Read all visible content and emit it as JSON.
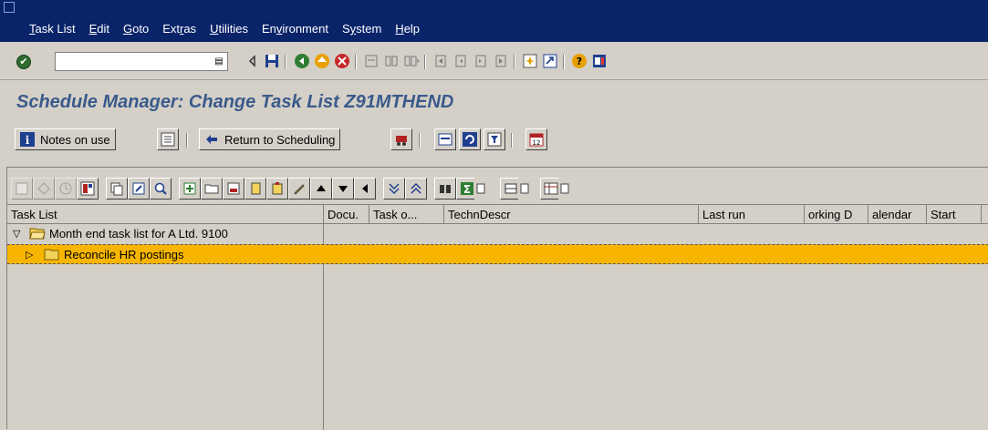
{
  "menu": {
    "items": [
      {
        "pre": "",
        "u": "T",
        "post": "ask List"
      },
      {
        "pre": "",
        "u": "E",
        "post": "dit"
      },
      {
        "pre": "",
        "u": "G",
        "post": "oto"
      },
      {
        "pre": "Ext",
        "u": "r",
        "post": "as"
      },
      {
        "pre": "",
        "u": "U",
        "post": "tilities"
      },
      {
        "pre": "En",
        "u": "v",
        "post": "ironment"
      },
      {
        "pre": "S",
        "u": "y",
        "post": "stem"
      },
      {
        "pre": "",
        "u": "H",
        "post": "elp"
      }
    ]
  },
  "command_field": {
    "value": ""
  },
  "title": "Schedule Manager: Change Task List Z91MTHEND",
  "app_toolbar": {
    "notes_on_use": "Notes on use",
    "return_to_scheduling": "Return to Scheduling"
  },
  "columns": [
    "Task List",
    "Docu.",
    "Task o...",
    "TechnDescr",
    "Last run",
    "orking D",
    "alendar",
    "Start"
  ],
  "tree": {
    "root": "Month end task list for A Ltd. 9100",
    "child": "Reconcile HR postings"
  },
  "colors": {
    "menubar": "#0a246a",
    "title": "#3a5a8c",
    "selection": "#f7b500",
    "folder": "#f3d25a"
  }
}
